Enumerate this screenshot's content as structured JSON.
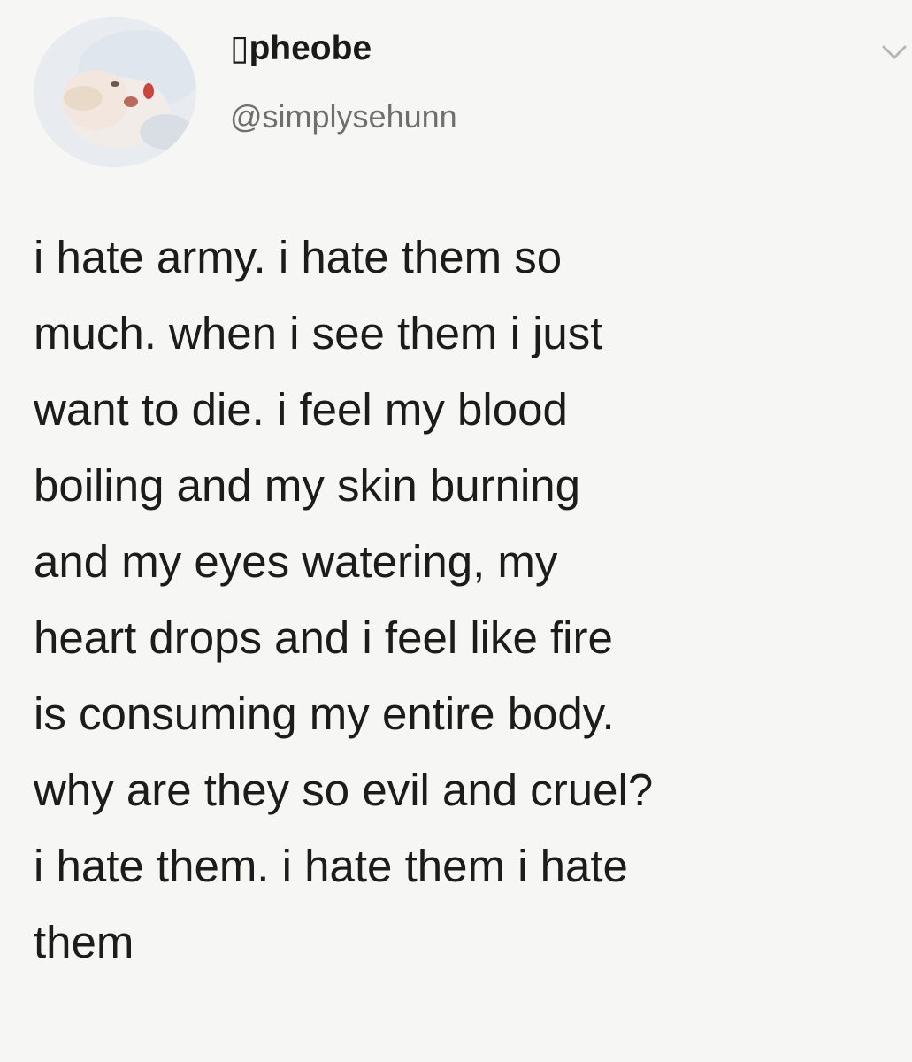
{
  "tweet": {
    "display_name": "▯pheobe",
    "handle": "@simplysehunn",
    "menu_icon": "chevron-down-icon",
    "avatar_icon": "profile-photo",
    "body_lines": [
      "i hate army. i hate them so",
      "much. when i see them i just",
      "want to die. i feel my blood",
      "boiling and my skin burning",
      "and my eyes watering, my",
      "heart drops and i feel like fire",
      "is consuming my entire body.",
      "why are they so evil and cruel?",
      "i hate them. i hate them i hate",
      "them"
    ]
  },
  "colors": {
    "background": "#f6f6f4",
    "text": "#1c1c1c",
    "handle": "#6f6f6f",
    "caret": "#b7b7b7"
  }
}
